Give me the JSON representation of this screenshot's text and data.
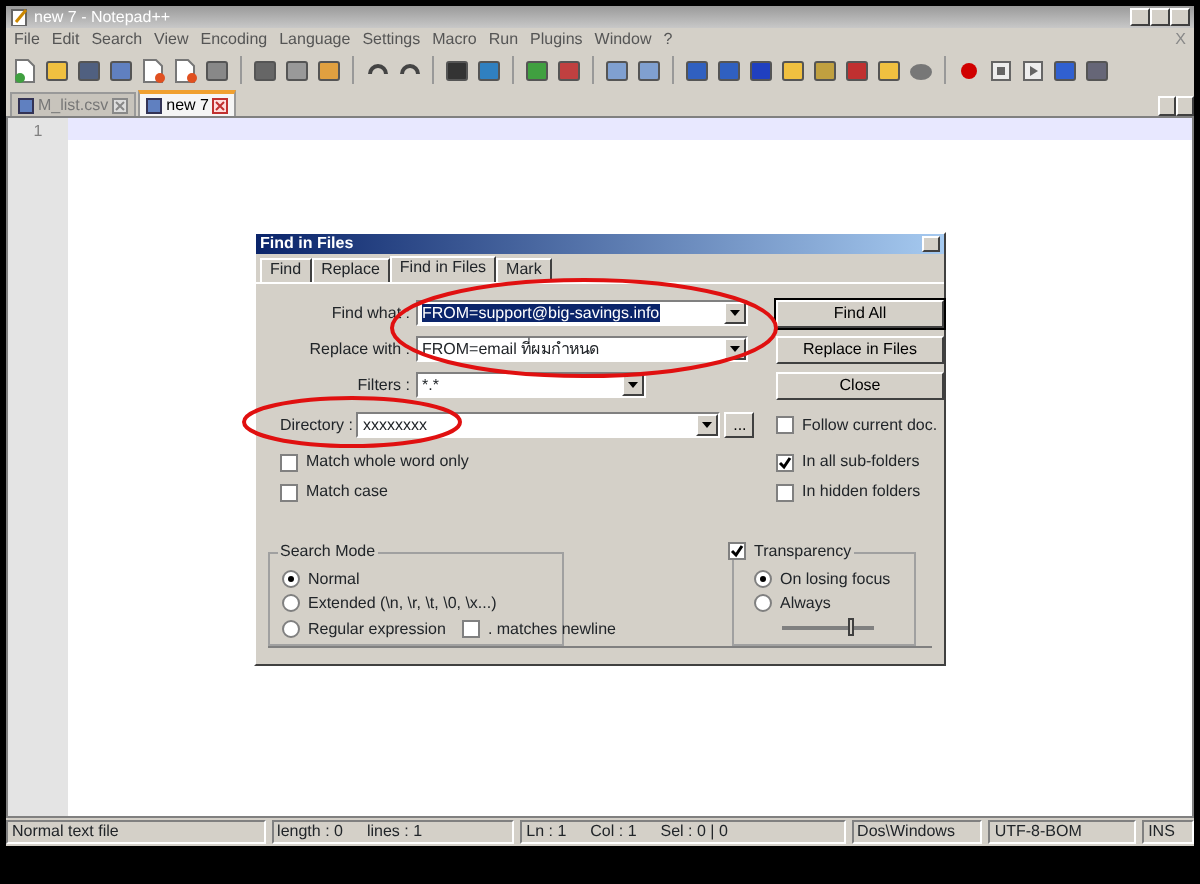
{
  "window": {
    "title": "new 7 - Notepad++"
  },
  "menu": [
    "File",
    "Edit",
    "Search",
    "View",
    "Encoding",
    "Language",
    "Settings",
    "Macro",
    "Run",
    "Plugins",
    "Window",
    "?"
  ],
  "menu_close": "X",
  "tabs": [
    {
      "label": "M_list.csv",
      "selected": false
    },
    {
      "label": "new 7",
      "selected": true
    }
  ],
  "editor": {
    "line_numbers": [
      "1"
    ]
  },
  "dialog": {
    "title": "Find in Files",
    "tabs": [
      {
        "label": "Find",
        "selected": false
      },
      {
        "label": "Replace",
        "selected": false
      },
      {
        "label": "Find in Files",
        "selected": true
      },
      {
        "label": "Mark",
        "selected": false
      }
    ],
    "fields": [
      {
        "label": "Find what :",
        "value": "FROM=support@big-savings.info",
        "highlighted": true
      },
      {
        "label": "Replace with :",
        "value": "FROM=email ที่ผมกำหนด",
        "highlighted": false
      },
      {
        "label": "Filters :",
        "value": "*.*",
        "highlighted": false
      }
    ],
    "directory": {
      "label": "Directory :",
      "value": "xxxxxxxx",
      "browse": "..."
    },
    "buttons": [
      "Find All",
      "Replace in Files",
      "Close"
    ],
    "left_options": [
      {
        "label": "Match whole word only",
        "checked": false
      },
      {
        "label": "Match case",
        "checked": false
      }
    ],
    "right_options": [
      {
        "label": "Follow current doc.",
        "checked": false
      },
      {
        "label": "In all sub-folders",
        "checked": true
      },
      {
        "label": "In hidden folders",
        "checked": false
      }
    ],
    "search_mode": {
      "title": "Search Mode",
      "options": [
        {
          "label": "Normal",
          "selected": true
        },
        {
          "label": "Extended (\\n, \\r, \\t, \\0, \\x...)",
          "selected": false
        },
        {
          "label": "Regular expression",
          "selected": false
        }
      ],
      "dot_newline": {
        "label": ". matches newline",
        "checked": false
      }
    },
    "transparency": {
      "label": "Transparency",
      "checked": true,
      "options": [
        {
          "label": "On losing focus",
          "selected": true
        },
        {
          "label": "Always",
          "selected": false
        }
      ],
      "level": 0.75
    }
  },
  "status_bar": [
    [
      "Normal text file"
    ],
    [
      "length : 0",
      "lines : 1"
    ],
    [
      "Ln : 1",
      "Col : 1",
      "Sel : 0 | 0"
    ],
    [
      "Dos\\Windows"
    ],
    [
      "UTF-8-BOM"
    ],
    [
      "INS"
    ]
  ]
}
